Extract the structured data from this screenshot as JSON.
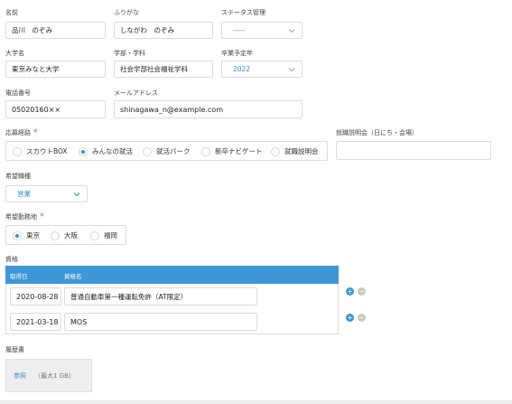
{
  "form": {
    "name": {
      "label": "名前",
      "value": "品川　のぞみ"
    },
    "furigana": {
      "label": "ふりがな",
      "value": "しながわ　のぞみ"
    },
    "status": {
      "label": "ステータス管理",
      "value": "-----"
    },
    "university": {
      "label": "大学名",
      "value": "東京みなと大学"
    },
    "faculty": {
      "label": "学部・学科",
      "value": "社会学部社会福祉学科"
    },
    "graduation": {
      "label": "卒業予定年",
      "value": "2022"
    },
    "phone": {
      "label": "電話番号",
      "value": "05020160××"
    },
    "email": {
      "label": "メールアドレス",
      "value": "shinagawa_n@example.com"
    },
    "route": {
      "label": "応募経路",
      "required_mark": "*",
      "options": [
        "スカウトBOX",
        "みんなの就活",
        "就活パーク",
        "新卒ナビゲート",
        "就職説明会"
      ],
      "selected": "みんなの就活"
    },
    "seminar": {
      "label": "就職説明会（日にち・会場）",
      "value": ""
    },
    "job_type": {
      "label": "希望職種",
      "value": "営業"
    },
    "location": {
      "label": "希望勤務地",
      "required_mark": "*",
      "options": [
        "東京",
        "大阪",
        "福岡"
      ],
      "selected": "東京"
    },
    "qualifications": {
      "label": "資格",
      "columns": [
        "取得日",
        "資格名"
      ],
      "rows": [
        {
          "date": "2020-08-28",
          "name": "普通自動車第一種運転免許（AT限定）"
        },
        {
          "date": "2021-03-18",
          "name": "MOS"
        }
      ],
      "add_symbol": "+",
      "remove_symbol": "−"
    },
    "resume": {
      "label": "履歴書",
      "browse": "参照",
      "hint": "（最大1 GB）"
    }
  },
  "colors": {
    "accent": "#3d96d6",
    "required": "#e0453a"
  }
}
